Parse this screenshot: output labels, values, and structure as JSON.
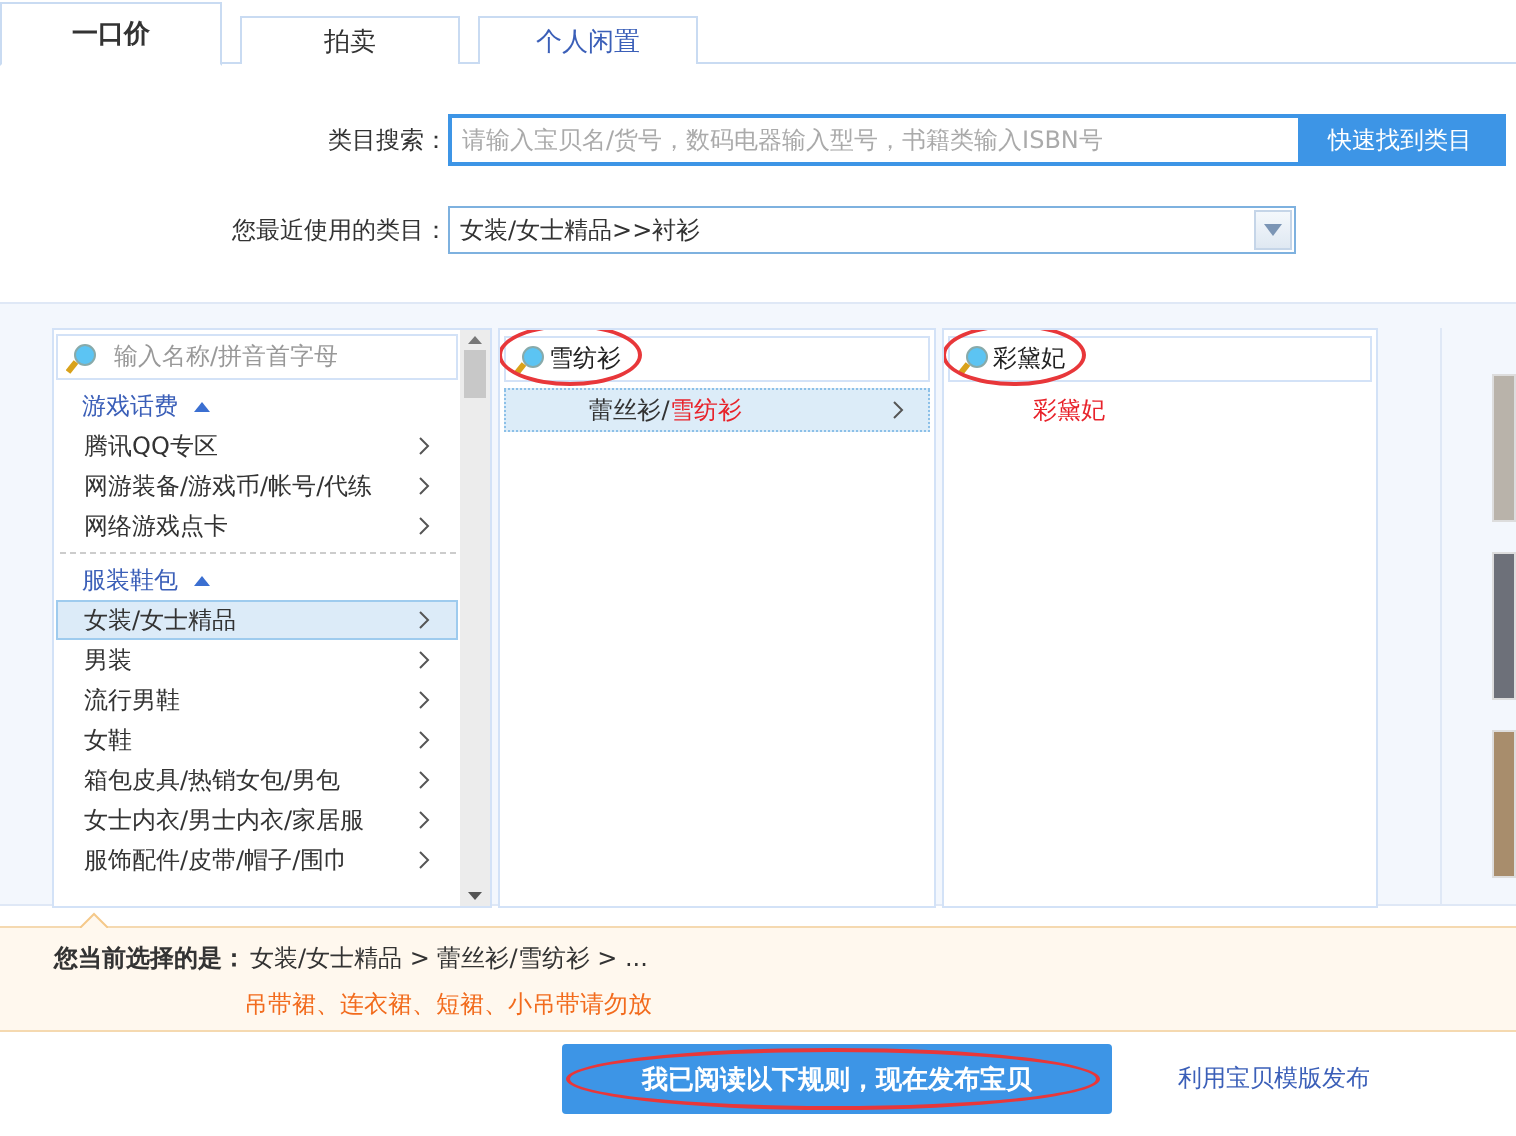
{
  "tabs": [
    {
      "label": "一口价",
      "selected": true
    },
    {
      "label": "拍卖",
      "selected": false
    },
    {
      "label": "个人闲置",
      "selected": false
    }
  ],
  "search": {
    "label": "类目搜索：",
    "placeholder": "请输入宝贝名/货号，数码电器输入型号，书籍类输入ISBN号",
    "button": "快速找到类目"
  },
  "recent": {
    "label": "您最近使用的类目：",
    "value": "女装/女士精品>>衬衫"
  },
  "column_1": {
    "placeholder": "输入名称/拼音首字母",
    "groups": [
      {
        "title": "游戏话费",
        "expanded": true,
        "items": [
          {
            "label": "腾讯QQ专区",
            "selected": false
          },
          {
            "label": "网游装备/游戏币/帐号/代练",
            "selected": false
          },
          {
            "label": "网络游戏点卡",
            "selected": false
          }
        ]
      },
      {
        "title": "服装鞋包",
        "expanded": true,
        "items": [
          {
            "label": "女装/女士精品",
            "selected": true
          },
          {
            "label": "男装",
            "selected": false
          },
          {
            "label": "流行男鞋",
            "selected": false
          },
          {
            "label": "女鞋",
            "selected": false
          },
          {
            "label": "箱包皮具/热销女包/男包",
            "selected": false
          },
          {
            "label": "女士内衣/男士内衣/家居服",
            "selected": false
          },
          {
            "label": "服饰配件/皮带/帽子/围巾",
            "selected": false
          }
        ]
      }
    ]
  },
  "result_columns": [
    {
      "search": {
        "value": "雪纺衫",
        "circled": true
      },
      "items": [
        {
          "parts": [
            {
              "text": "蕾丝衫/",
              "match": false
            },
            {
              "text": "雪纺衫",
              "match": true
            }
          ],
          "selected": true,
          "has_children": true
        }
      ]
    },
    {
      "search": {
        "value": "彩黛妃",
        "circled": true
      },
      "items": [
        {
          "parts": [
            {
              "text": "彩黛妃",
              "match": true
            }
          ],
          "selected": false,
          "has_children": false
        }
      ]
    }
  ],
  "selection": {
    "label": "您当前选择的是：",
    "path": "女装/女士精品 > 蕾丝衫/雪纺衫 > ...",
    "warning": "吊带裙、连衣裙、短裙、小吊带请勿放"
  },
  "publish": {
    "label": "我已阅读以下规则，现在发布宝贝",
    "circled": true
  },
  "template_link": "利用宝贝模版发布"
}
